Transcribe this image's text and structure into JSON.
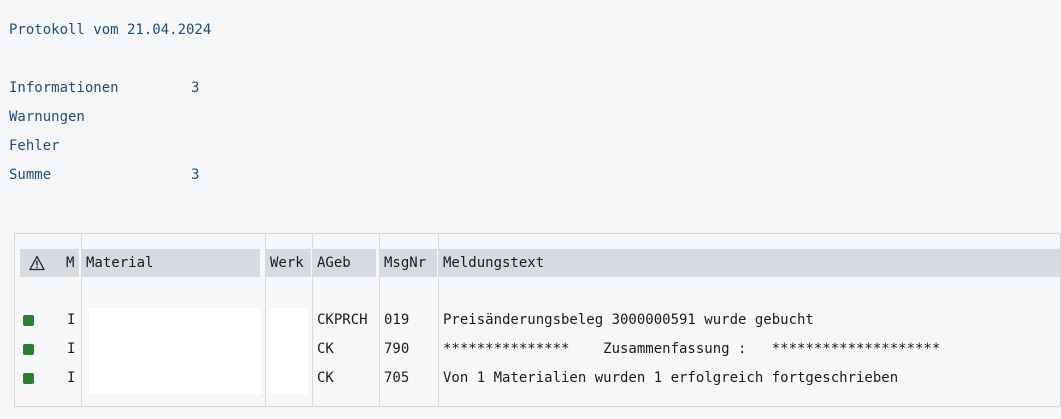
{
  "log": {
    "title": "Protokoll vom 21.04.2024",
    "stats": [
      {
        "label": "Informationen",
        "value": "3"
      },
      {
        "label": "Warnungen",
        "value": ""
      },
      {
        "label": "Fehler",
        "value": ""
      },
      {
        "label": "Summe",
        "value": "3"
      }
    ]
  },
  "table": {
    "columns": {
      "status": "⚠",
      "m": "M",
      "material": "Material",
      "werk": "Werk",
      "ageb": "AGeb",
      "msgnr": "MsgNr",
      "text": "Meldungstext"
    },
    "rows": [
      {
        "status_icon": "green-square",
        "status_color": "#2f7d32",
        "m": "I",
        "material": "",
        "werk": "",
        "ageb": "CKPRCH",
        "msgnr": "019",
        "text": "Preisänderungsbeleg 3000000591 wurde gebucht"
      },
      {
        "status_icon": "green-square",
        "status_color": "#2f7d32",
        "m": "I",
        "material": "",
        "werk": "",
        "ageb": "CK",
        "msgnr": "790",
        "text": "***************    Zusammenfassung :   ********************"
      },
      {
        "status_icon": "green-square",
        "status_color": "#2f7d32",
        "m": "I",
        "material": "",
        "werk": "",
        "ageb": "CK",
        "msgnr": "705",
        "text": "Von 1 Materialien wurden 1 erfolgreich fortgeschrieben"
      }
    ]
  }
}
